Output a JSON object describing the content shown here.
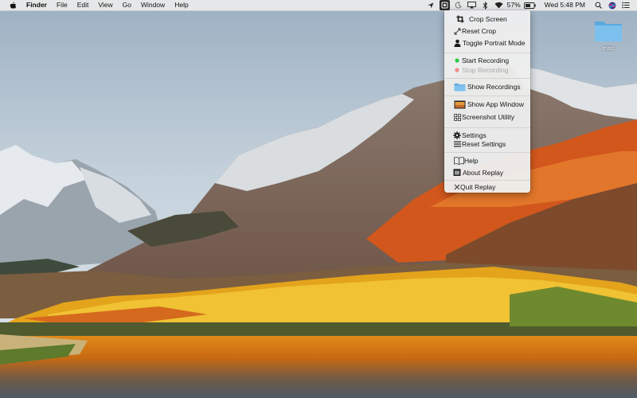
{
  "menubar": {
    "app_name": "Finder",
    "menus": [
      "File",
      "Edit",
      "View",
      "Go",
      "Window",
      "Help"
    ],
    "battery_percent": "57%",
    "clock": "Wed 5:48 PM",
    "icons": [
      "apple-icon",
      "location-arrow-icon",
      "replay-icon",
      "moon-icon",
      "airplay-icon",
      "bluetooth-icon",
      "wifi-icon",
      "battery-icon",
      "spotlight-icon",
      "siri-icon",
      "notification-center-icon"
    ]
  },
  "dropdown": {
    "items": {
      "crop_screen": "Crop Screen",
      "reset_crop": "Reset Crop",
      "toggle_portrait": "Toggle Portrait Mode",
      "start_recording": "Start Recording",
      "stop_recording": "Stop Recording",
      "show_recordings": "Show Recordings",
      "show_app_window": "Show App Window",
      "screenshot_utility": "Screenshot Utility",
      "settings": "Settings",
      "reset_settings": "Reset Settings",
      "help": "Help",
      "about_replay": "About Replay",
      "quit_replay": "Quit Replay"
    },
    "colors": {
      "start_dot": "#2fc94a",
      "stop_dot": "#f08c8c"
    }
  },
  "desktop": {
    "folder_label": "misc"
  }
}
